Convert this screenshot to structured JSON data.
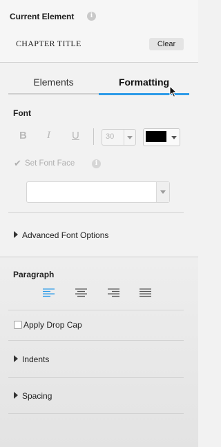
{
  "current_element": {
    "title": "Current Element",
    "info_glyph": "i",
    "value": "CHAPTER TITLE",
    "clear_label": "Clear"
  },
  "tabs": [
    {
      "label": "Elements",
      "active": false
    },
    {
      "label": "Formatting",
      "active": true
    }
  ],
  "font": {
    "heading": "Font",
    "bold_label": "B",
    "italic_label": "I",
    "underline_label": "U",
    "size_value": "30",
    "color": "#000000",
    "set_font_face_label": "Set Font Face",
    "set_font_face_checked": true,
    "font_face_value": "",
    "advanced_label": "Advanced Font Options"
  },
  "paragraph": {
    "heading": "Paragraph",
    "alignment_options": [
      "align-left-icon",
      "align-center-icon",
      "align-right-icon",
      "align-justify-icon"
    ],
    "active_alignment": "align-left-icon",
    "drop_cap_label": "Apply Drop Cap",
    "drop_cap_checked": false,
    "indents_label": "Indents",
    "spacing_label": "Spacing"
  },
  "colors": {
    "accent": "#2e9be8",
    "disabled": "#b5b5b5"
  }
}
